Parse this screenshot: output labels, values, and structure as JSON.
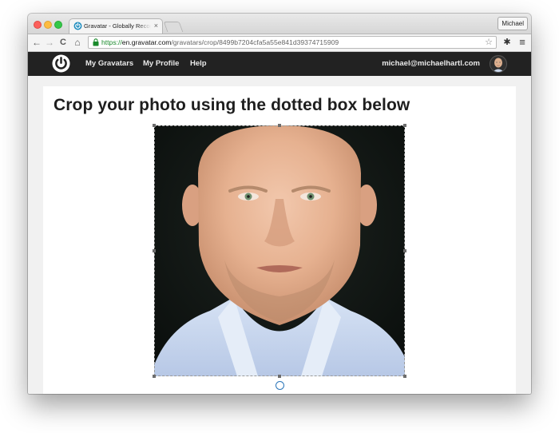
{
  "browser": {
    "tab_title": "Gravatar - Globally Recognized Avatars",
    "tab_close": "×",
    "profile_name": "Michael",
    "url_scheme": "https://",
    "url_host": "en.gravatar.com",
    "url_path": "/gravatars/crop/8499b7204cfa5a55e841d39374715909",
    "nav": {
      "back": "←",
      "forward": "→",
      "reload": "C",
      "home": "⌂"
    },
    "icons": {
      "star": "☆",
      "settings": "✱",
      "menu": "≡"
    }
  },
  "site": {
    "nav_items": [
      {
        "label": "My Gravatars"
      },
      {
        "label": "My Profile"
      },
      {
        "label": "Help"
      }
    ],
    "user_email": "michael@michaelhartl.com"
  },
  "main": {
    "heading": "Crop your photo using the dotted box below"
  },
  "colors": {
    "topnav_bg": "#222222",
    "url_scheme": "#1a8a2c",
    "rotate_icon": "#2b76b9"
  },
  "icons_semantic": [
    "gravatar-logo-icon",
    "lock-icon",
    "star-icon",
    "gear-icon",
    "menu-icon",
    "rotate-icon"
  ]
}
